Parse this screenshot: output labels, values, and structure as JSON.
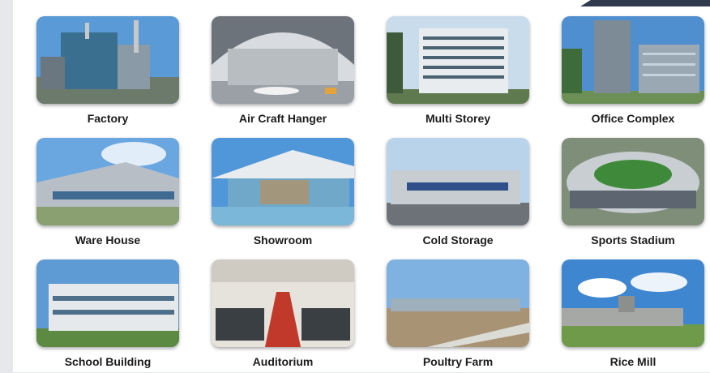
{
  "categories": [
    {
      "label": "Factory",
      "icon": "factory-image"
    },
    {
      "label": "Air Craft Hanger",
      "icon": "hangar-image"
    },
    {
      "label": "Multi Storey",
      "icon": "multi-storey-image"
    },
    {
      "label": "Office Complex",
      "icon": "office-complex-image"
    },
    {
      "label": "Ware House",
      "icon": "warehouse-image"
    },
    {
      "label": "Showroom",
      "icon": "showroom-image"
    },
    {
      "label": "Cold Storage",
      "icon": "cold-storage-image"
    },
    {
      "label": "Sports Stadium",
      "icon": "stadium-image"
    },
    {
      "label": "School Building",
      "icon": "school-image"
    },
    {
      "label": "Auditorium",
      "icon": "auditorium-image"
    },
    {
      "label": "Poultry Farm",
      "icon": "poultry-farm-image"
    },
    {
      "label": "Rice Mill",
      "icon": "rice-mill-image"
    }
  ]
}
